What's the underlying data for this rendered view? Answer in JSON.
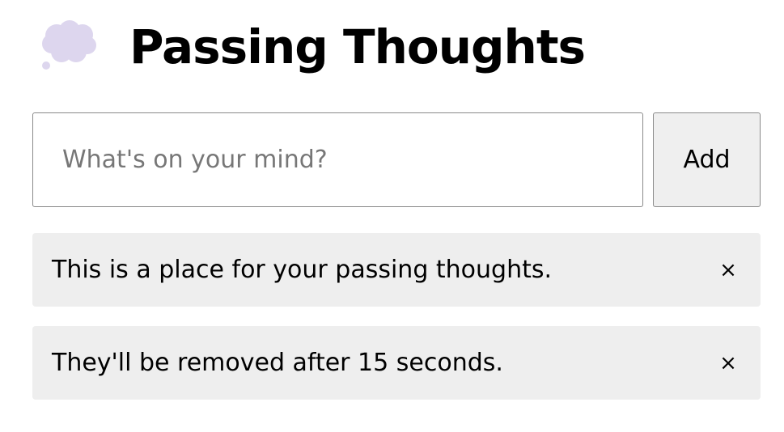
{
  "header": {
    "logo_icon": "thought-bubble-icon",
    "logo_color": "#ddd6ee",
    "title": "Passing Thoughts"
  },
  "form": {
    "input_placeholder": "What's on your mind?",
    "input_value": "",
    "add_label": "Add"
  },
  "thoughts": [
    {
      "text": "This is a place for your passing thoughts.",
      "remove_label": "×",
      "remove_icon": "close-icon"
    },
    {
      "text": "They'll be removed after 15 seconds.",
      "remove_label": "×",
      "remove_icon": "close-icon"
    }
  ],
  "colors": {
    "thought_background": "#eeeeee",
    "button_background": "#efefef",
    "border": "#8a8a8a"
  }
}
